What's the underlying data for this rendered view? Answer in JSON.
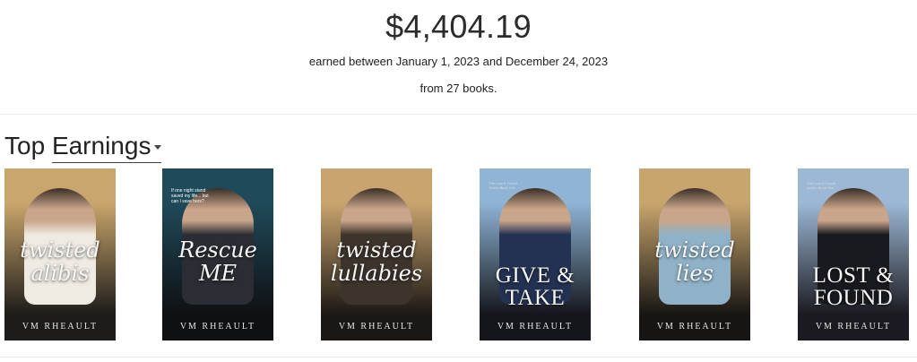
{
  "summary": {
    "amount": "$4,404.19",
    "range": "earned between January 1, 2023 and December 24, 2023",
    "count": "from 27 books."
  },
  "section": {
    "title_prefix": "Top",
    "dropdown_value": "Earnings"
  },
  "books": [
    {
      "title": "twisted\nalibis",
      "author": "VM RHEAULT",
      "style": "script",
      "sky": "#c9a66b",
      "ground": "#1d1c1a",
      "figure": "#efeae2"
    },
    {
      "title": "Rescue\nME",
      "author": "VM RHEAULT",
      "style": "script",
      "tagline": "If one night stand saved my life... but can I save hers?",
      "sky": "#1f4a5a",
      "ground": "#0e1012",
      "figure": "#2a2d33"
    },
    {
      "title": "twisted\nlullabies",
      "author": "VM RHEAULT",
      "style": "script",
      "sky": "#c9a46e",
      "ground": "#1b1714",
      "figure": "#3d342c"
    },
    {
      "title": "GIVE &\nTAKE",
      "author": "VM RHEAULT",
      "style": "block",
      "series": "The Lost & Found Series Book One",
      "sky": "#8fb4d6",
      "ground": "#14161b",
      "figure": "#233252"
    },
    {
      "title": "twisted\nlies",
      "author": "VM RHEAULT",
      "style": "script",
      "sky": "#c8a56d",
      "ground": "#171513",
      "figure": "#8fb2c8"
    },
    {
      "title": "LOST &\nFOUND",
      "author": "VM RHEAULT",
      "style": "block",
      "series": "The Lost & Found Series Book Two",
      "sky": "#9cb8d5",
      "ground": "#1b1a20",
      "figure": "#191a1f"
    }
  ]
}
